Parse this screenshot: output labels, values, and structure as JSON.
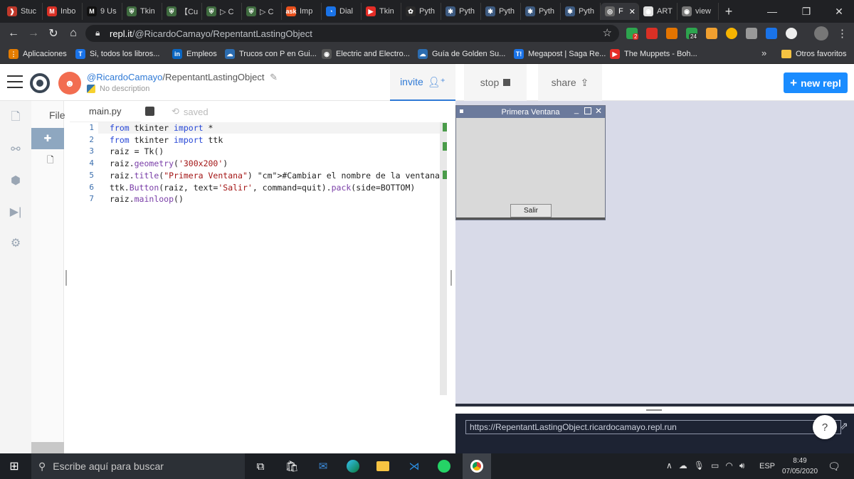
{
  "browser": {
    "tabs": [
      {
        "label": "Stuc",
        "color": "#c0392b",
        "glyph": "❱"
      },
      {
        "label": "Inbo",
        "color": "#d93025",
        "glyph": "M"
      },
      {
        "label": "9 Us",
        "color": "#111111",
        "glyph": "M"
      },
      {
        "label": "Tkin",
        "color": "#3f6b3f",
        "glyph": "⛨"
      },
      {
        "label": "【Cu",
        "color": "#3f6b3f",
        "glyph": "⛨"
      },
      {
        "label": "▷ C",
        "color": "#3f6b3f",
        "glyph": "⛨"
      },
      {
        "label": "▷ C",
        "color": "#3f6b3f",
        "glyph": "⛨"
      },
      {
        "label": "Imp",
        "color": "#e8501c",
        "glyph": "ask"
      },
      {
        "label": "Dial",
        "color": "#1a73e8",
        "glyph": "◔"
      },
      {
        "label": "Tkin",
        "color": "#e52d27",
        "glyph": "▶"
      },
      {
        "label": "Pyth",
        "color": "#2b2b2b",
        "glyph": "✿"
      },
      {
        "label": "Pyth",
        "color": "#3d5a80",
        "glyph": "✱"
      },
      {
        "label": "Pyth",
        "color": "#3d5a80",
        "glyph": "✱"
      },
      {
        "label": "Pyth",
        "color": "#3d5a80",
        "glyph": "✱"
      },
      {
        "label": "Pyth",
        "color": "#3d5a80",
        "glyph": "✱"
      },
      {
        "label": "F",
        "color": "#666666",
        "glyph": "◎",
        "active": true
      },
      {
        "label": "ART",
        "color": "#e0e0e0",
        "glyph": "◉"
      },
      {
        "label": "view",
        "color": "#777777",
        "glyph": "◉"
      }
    ],
    "new_tab": "+",
    "url_host": "repl.it",
    "url_path": "/@RicardoCamayo/RepentantLastingObject",
    "ext_badges": [
      "2",
      "24"
    ],
    "bookmarks": [
      {
        "label": "Aplicaciones",
        "color": "#e57c00",
        "glyph": "⋮"
      },
      {
        "label": "Si, todos los libros...",
        "color": "#1a73e8",
        "glyph": "T"
      },
      {
        "label": "Empleos",
        "color": "#0a66c2",
        "glyph": "in"
      },
      {
        "label": "Trucos con P en Gui...",
        "color": "#2b6cb0",
        "glyph": "☁"
      },
      {
        "label": "Electric and Electro...",
        "color": "#555555",
        "glyph": "◉"
      },
      {
        "label": "Guía de Golden Su...",
        "color": "#2b6cb0",
        "glyph": "☁"
      },
      {
        "label": "Megapost | Saga Re...",
        "color": "#1a73e8",
        "glyph": "T!"
      },
      {
        "label": "The Muppets - Boh...",
        "color": "#e52d27",
        "glyph": "▶"
      }
    ],
    "bookmarks_more": "»",
    "other_bookmarks": "Otros favoritos"
  },
  "repl": {
    "owner": "@RicardoCamayo",
    "name": "/RepentantLastingObject",
    "description": "No description",
    "invite_label": "invite",
    "stop_label": "stop",
    "share_label": "share",
    "new_repl_label": "new repl",
    "files_label": "File",
    "editor_tab": "main.py",
    "saved_label": "saved",
    "accent": "#1a8cff"
  },
  "code": {
    "line_numbers": [
      "1",
      "2",
      "3",
      "4",
      "5",
      "6",
      "7"
    ],
    "lines": [
      "from tkinter import *",
      "from tkinter import ttk",
      "raiz = Tk()",
      "raiz.geometry('300x200')",
      "raiz.title(\"Primera Ventana\") #Cambiar el nombre de la ventana",
      "ttk.Button(raiz, text='Salir', command=quit).pack(side=BOTTOM)",
      "raiz.mainloop()"
    ]
  },
  "tk_window": {
    "title": "Primera Ventana",
    "button_label": "Salir"
  },
  "console": {
    "url": "https://RepentantLastingObject.ricardocamayo.repl.run",
    "help": "?"
  },
  "taskbar": {
    "search_placeholder": "Escribe aquí para buscar",
    "language": "ESP",
    "time": "8:49",
    "date": "07/05/2020"
  }
}
